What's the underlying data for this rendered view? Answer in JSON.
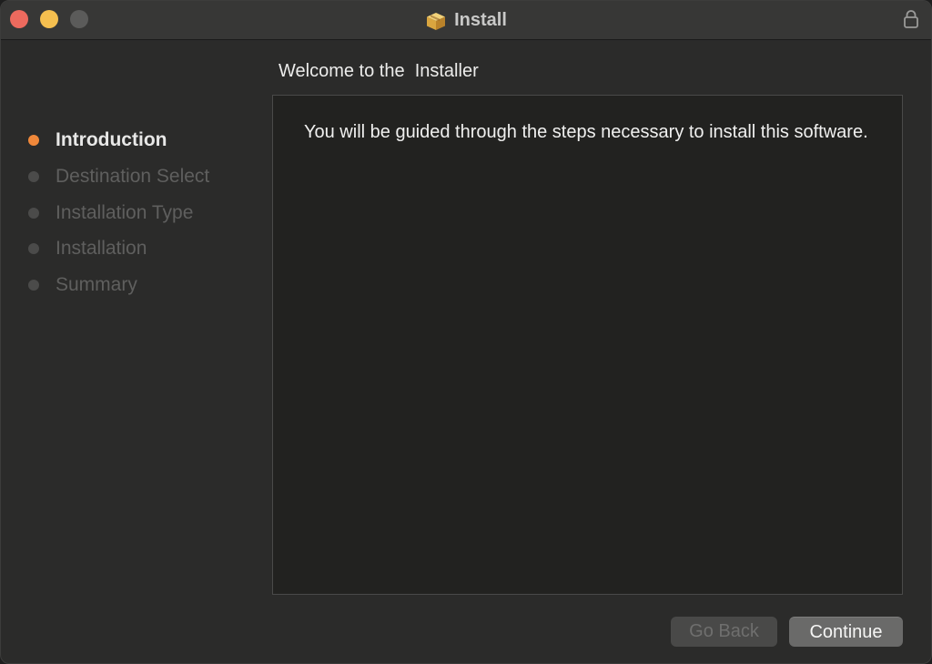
{
  "window": {
    "title": "Install",
    "icon": "package-icon",
    "lock_icon": "lock-icon"
  },
  "sidebar": {
    "steps": [
      {
        "label": "Introduction",
        "active": true
      },
      {
        "label": "Destination Select",
        "active": false
      },
      {
        "label": "Installation Type",
        "active": false
      },
      {
        "label": "Installation",
        "active": false
      },
      {
        "label": "Summary",
        "active": false
      }
    ]
  },
  "main": {
    "heading": "Welcome to the  Installer",
    "body": "You will be guided through the steps necessary to install this software."
  },
  "buttons": {
    "back_label": "Go Back",
    "continue_label": "Continue"
  },
  "colors": {
    "active_step": "#f0883a",
    "close": "#ed6a5e",
    "minimize": "#f5bf4f",
    "zoom": "#5b5b5a"
  }
}
